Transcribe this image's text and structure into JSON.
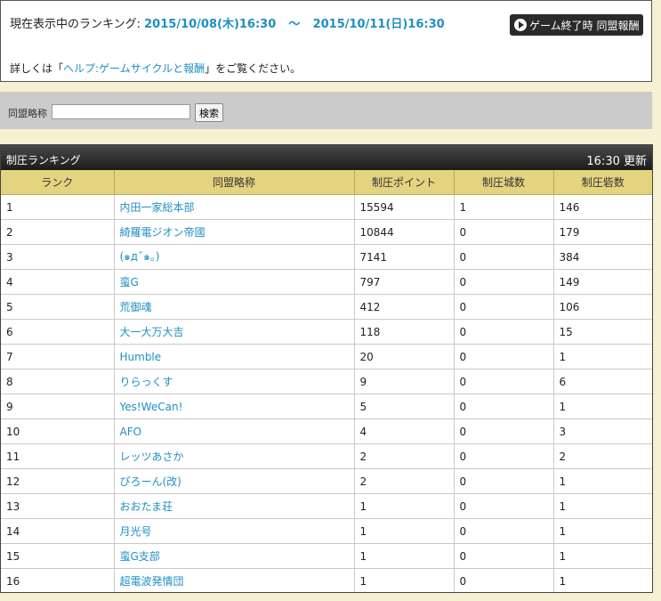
{
  "info": {
    "range_label": "現在表示中のランキング:",
    "start": "2015/10/08(木)16:30",
    "separator": "～",
    "end": "2015/10/11(日)16:30",
    "end_button_label": "ゲーム終了時 同盟報酬",
    "help_prefix": "詳しくは「",
    "help_link": "ヘルプ:ゲームサイクルと報酬",
    "help_suffix": "」をご覧ください。"
  },
  "search": {
    "label": "同盟略称",
    "value": "",
    "button_label": "検索"
  },
  "ranking": {
    "title": "制圧ランキング",
    "updated": "16:30 更新",
    "columns": [
      "ランク",
      "同盟略称",
      "制圧ポイント",
      "制圧城数",
      "制圧砦数"
    ],
    "rows": [
      [
        "1",
        "内田一家総本部",
        "15594",
        "1",
        "146"
      ],
      [
        "2",
        "綺羅電ジオン帝國",
        "10844",
        "0",
        "179"
      ],
      [
        "3",
        "(๑дˇ๑。)",
        "7141",
        "0",
        "384"
      ],
      [
        "4",
        "蛮G",
        "797",
        "0",
        "149"
      ],
      [
        "5",
        "荒御魂",
        "412",
        "0",
        "106"
      ],
      [
        "6",
        "大一大万大吉",
        "118",
        "0",
        "15"
      ],
      [
        "7",
        "Humble",
        "20",
        "0",
        "1"
      ],
      [
        "8",
        "りらっくす",
        "9",
        "0",
        "6"
      ],
      [
        "9",
        "Yes!WeCan!",
        "5",
        "0",
        "1"
      ],
      [
        "10",
        "AFO",
        "4",
        "0",
        "3"
      ],
      [
        "11",
        "レッツあさか",
        "2",
        "0",
        "2"
      ],
      [
        "12",
        "ぴろーん(改)",
        "2",
        "0",
        "1"
      ],
      [
        "13",
        "おおたま荘",
        "1",
        "0",
        "1"
      ],
      [
        "14",
        "月光号",
        "1",
        "0",
        "1"
      ],
      [
        "15",
        "蛮G支部",
        "1",
        "0",
        "1"
      ],
      [
        "16",
        "超電波発情団",
        "1",
        "0",
        "1"
      ]
    ]
  },
  "icons": {
    "end_button_icon": "play-circle-icon"
  },
  "colors": {
    "link": "#1f8fc4",
    "table_header": "#e4d37f",
    "panel_header": "#1b1b1b",
    "page_bg": "#f6f1d2"
  }
}
